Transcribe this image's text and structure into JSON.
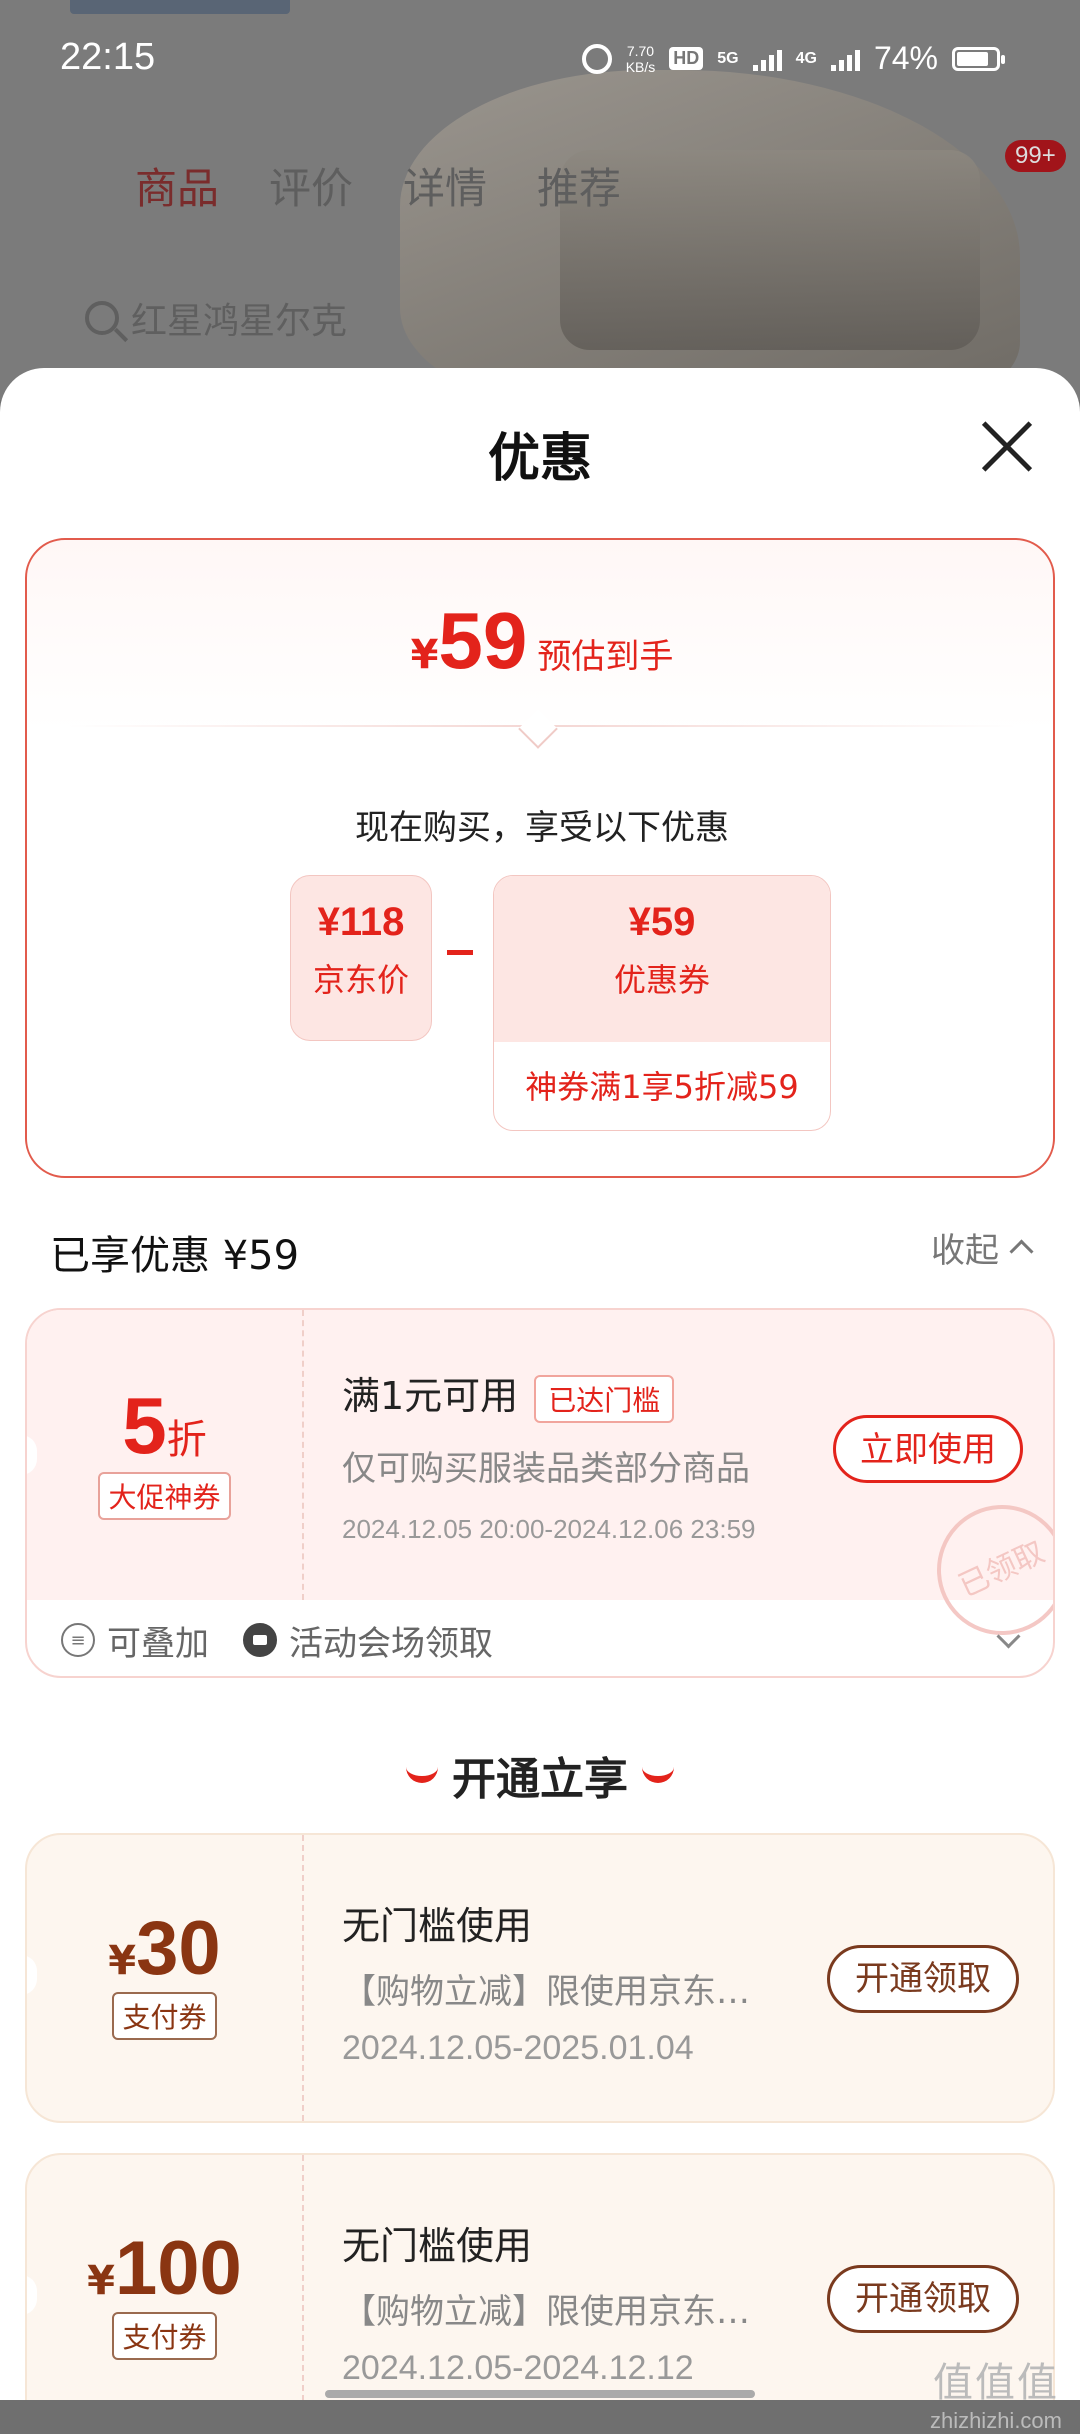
{
  "status_bar": {
    "time": "22:15",
    "speed": "7.70",
    "speed_unit": "KB/s",
    "hd": "HD",
    "net1": "5G",
    "net2": "4G",
    "battery": "74%"
  },
  "background": {
    "cart_badge": "99+",
    "tabs": [
      "商品",
      "评价",
      "详情",
      "推荐"
    ],
    "search_placeholder": "红星鸿星尔克"
  },
  "sheet": {
    "title": "优惠",
    "summary": {
      "currency": "¥",
      "final_price": "59",
      "final_label": "预估到手",
      "subtitle": "现在购买，享受以下优惠",
      "jd_price": "¥118",
      "jd_price_label": "京东价",
      "coupon_value": "¥59",
      "coupon_label": "优惠券",
      "coupon_desc": "神券满1享5折减59"
    },
    "enjoyed": {
      "title": "已享优惠 ¥59",
      "collapse_label": "收起"
    },
    "coupon1": {
      "value": "5",
      "unit": "折",
      "tag": "大促神券",
      "title": "满1元可用",
      "status": "已达门槛",
      "desc": "仅可购买服装品类部分商品",
      "date": "2024.12.05 20:00-2024.12.06 23:59",
      "button": "立即使用",
      "stamp": "已领取",
      "foot1": "可叠加",
      "foot2": "活动会场领取"
    },
    "open_section_title": "开通立享",
    "pay_coupons": [
      {
        "currency": "¥",
        "value": "30",
        "tag": "支付券",
        "title": "无门槛使用",
        "desc": "【购物立减】限使用京东…",
        "date": "2024.12.05-2025.01.04",
        "button": "开通领取"
      },
      {
        "currency": "¥",
        "value": "100",
        "tag": "支付券",
        "title": "无门槛使用",
        "desc": "【购物立减】限使用京东…",
        "date": "2024.12.05-2024.12.12",
        "button": "开通领取"
      }
    ]
  },
  "watermark": {
    "text_big": "值值值",
    "text_small": "zhizhizhi.com"
  }
}
